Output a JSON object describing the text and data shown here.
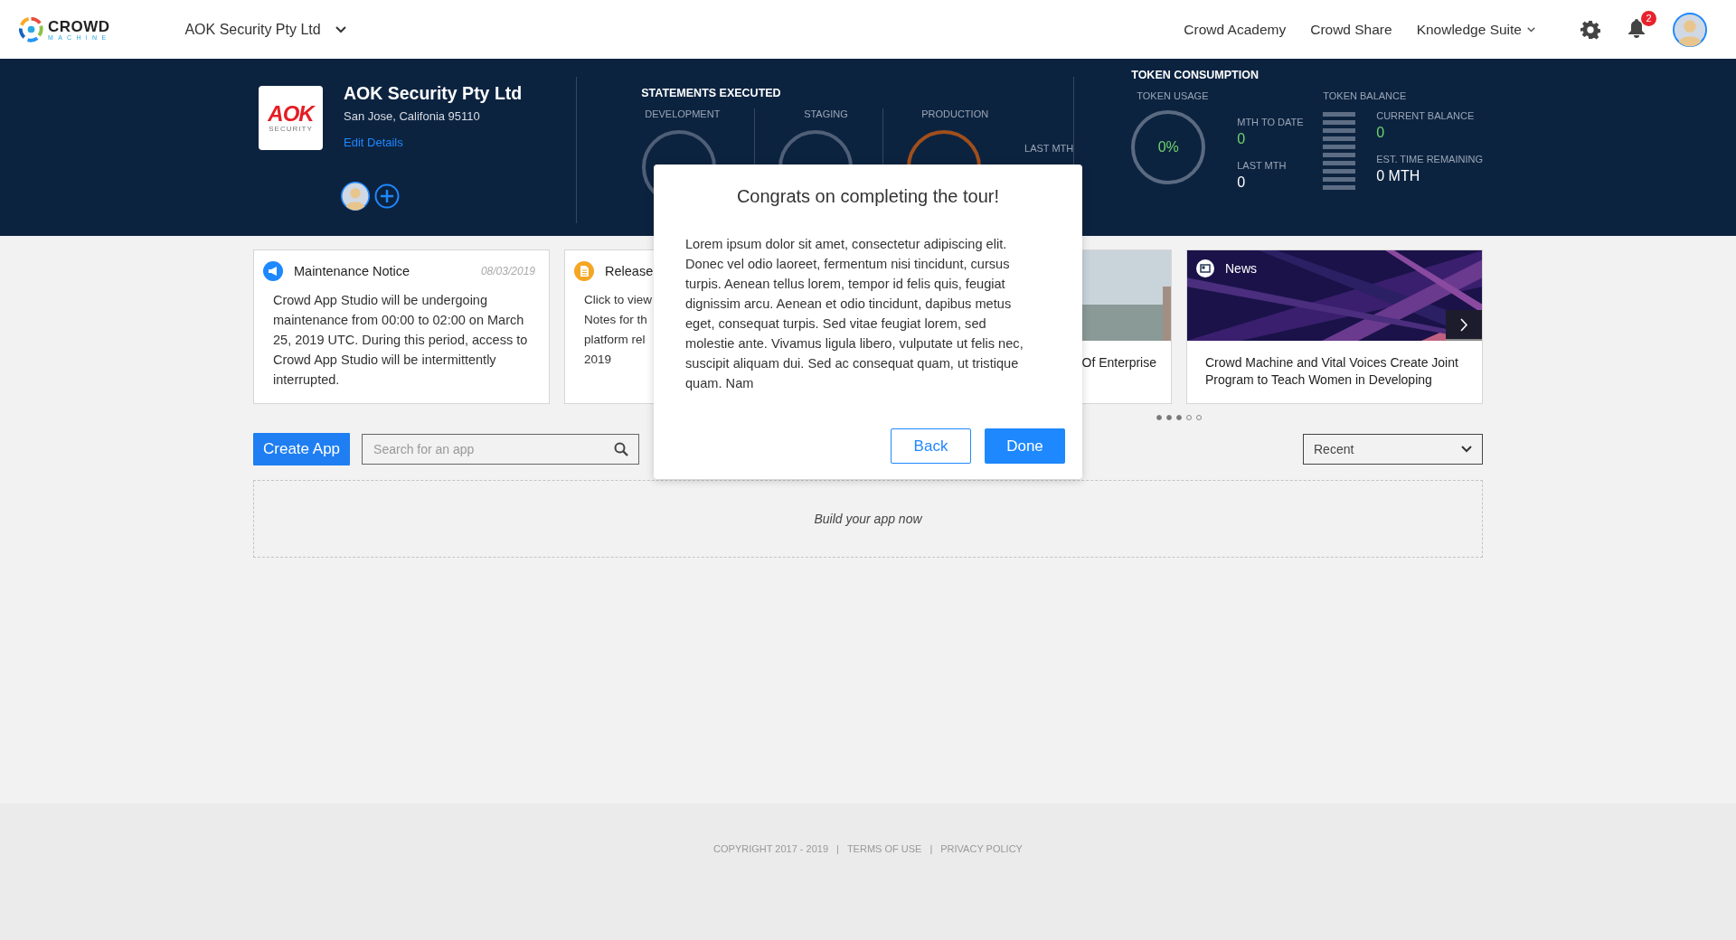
{
  "top_bar": {
    "logo": {
      "name": "CROWD",
      "tagline": "MACHINE"
    },
    "org_selector": "AOK Security Pty Ltd",
    "nav_links": [
      {
        "label": "Crowd Academy",
        "kind": "link"
      },
      {
        "label": "Crowd Share",
        "kind": "link"
      },
      {
        "label": "Knowledge Suite",
        "kind": "dropdown"
      }
    ],
    "notification_count": "2"
  },
  "org": {
    "logo_text": "AOK",
    "logo_subtext": "SECURITY",
    "name": "AOK Security Pty Ltd",
    "address": "San Jose, Califonia 95110",
    "edit_link": "Edit Details"
  },
  "statements": {
    "title": "STATEMENTS EXECUTED",
    "gauges": [
      {
        "label": "DEVELOPMENT",
        "color": "#4f5f77"
      },
      {
        "label": "STAGING",
        "color": "#4f5f77"
      },
      {
        "label": "PRODUCTION",
        "color": "#a14f1c"
      }
    ],
    "last_month": {
      "label": "LAST MTH"
    }
  },
  "tokens": {
    "title": "TOKEN CONSUMPTION",
    "usage_label": "TOKEN USAGE",
    "usage_value": "0%",
    "month_to_date": {
      "label": "MTH TO DATE",
      "value": "0"
    },
    "last_month": {
      "label": "LAST MTH",
      "value": "0"
    },
    "balance_label": "TOKEN BALANCE",
    "current_balance": {
      "label": "CURRENT BALANCE",
      "value": "0"
    },
    "time_remaining": {
      "label": "EST. TIME REMAINING",
      "value": "0 MTH"
    }
  },
  "cards": [
    {
      "kind": "maintenance",
      "title": "Maintenance Notice",
      "date": "08/03/2019",
      "body": "Crowd App Studio will be undergoing maintenance from 00:00 to 02:00 on March 25, 2019 UTC. During this period, access to Crowd App Studio will be intermittently interrupted."
    },
    {
      "kind": "release",
      "title": "Release",
      "body": "Click to view\nNotes for th\nplatform rel\n2019"
    },
    {
      "kind": "article",
      "title": "Of Enterprise"
    },
    {
      "kind": "news",
      "label": "News",
      "title": "Crowd Machine and Vital Voices Create Joint Program to Teach Women in Developing"
    }
  ],
  "carousel_dots": [
    {
      "filled": true
    },
    {
      "filled": true
    },
    {
      "filled": true
    },
    {
      "filled": false
    },
    {
      "filled": false
    }
  ],
  "toolbar": {
    "create_button": "Create App",
    "search_placeholder": "Search for an app",
    "sort": "Recent"
  },
  "empty_state": "Build your app now",
  "footer": {
    "items": [
      "COPYRIGHT 2017 - 2019",
      "TERMS OF USE",
      "PRIVACY POLICY"
    ],
    "separator": "|"
  },
  "modal": {
    "title": "Congrats on completing the tour!",
    "body": "Lorem ipsum dolor sit amet, consectetur adipiscing elit. Donec vel odio laoreet, fermentum nisi tincidunt, cursus turpis. Aenean tellus lorem, tempor id felis quis, feugiat dignissim arcu. Aenean et odio tincidunt, dapibus metus eget, consequat turpis. Sed vitae feugiat lorem, sed molestie ante. Vivamus ligula libero, vulputate ut felis nec, suscipit aliquam dui. Sed ac consequat quam, ut tristique quam. Nam",
    "buttons": [
      {
        "label": "Back",
        "kind": "secondary"
      },
      {
        "label": "Done",
        "kind": "primary"
      }
    ]
  }
}
